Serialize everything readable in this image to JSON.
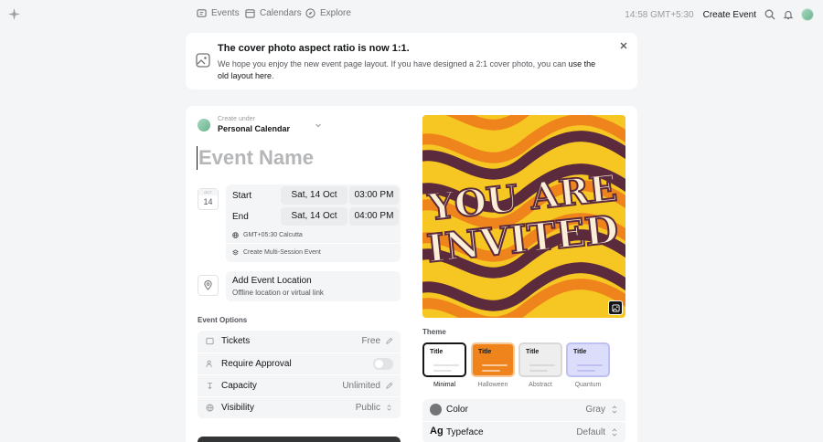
{
  "nav": {
    "logo_icon": "sparkle-icon",
    "items": [
      {
        "label": "Events",
        "icon": "ticket-icon"
      },
      {
        "label": "Calendars",
        "icon": "calendar-icon"
      },
      {
        "label": "Explore",
        "icon": "compass-icon"
      }
    ],
    "time": "14:58 GMT+5:30",
    "create_label": "Create Event"
  },
  "banner": {
    "title": "The cover photo aspect ratio is now 1:1.",
    "text": "We hope you enjoy the new event page layout. If you have designed a 2:1 cover photo, you can ",
    "link": "use the old layout here",
    "suffix": "."
  },
  "event": {
    "create_under": "Create under",
    "calendar": "Personal Calendar",
    "name_placeholder": "Event Name",
    "date_badge": {
      "month": "OCT",
      "day": "14"
    },
    "start": {
      "label": "Start",
      "date": "Sat, 14 Oct",
      "time": "03:00 PM"
    },
    "end": {
      "label": "End",
      "date": "Sat, 14 Oct",
      "time": "04:00 PM"
    },
    "timezone": "GMT+05:30 Calcutta",
    "multi_session": "Create Multi-Session Event",
    "location": {
      "title": "Add Event Location",
      "subtitle": "Offline location or virtual link"
    }
  },
  "options": {
    "label": "Event Options",
    "rows": [
      {
        "label": "Tickets",
        "value": "Free",
        "icon": "ticket-icon",
        "action": "pencil-icon"
      },
      {
        "label": "Require Approval",
        "value": "",
        "icon": "person-check-icon",
        "action": "toggle",
        "enabled": false
      },
      {
        "label": "Capacity",
        "value": "Unlimited",
        "icon": "capacity-icon",
        "action": "pencil-icon"
      },
      {
        "label": "Visibility",
        "value": "Public",
        "icon": "globe-icon",
        "action": "updown-chevron-icon"
      }
    ]
  },
  "cover": {
    "text_line1": "YOU ARE",
    "text_line2": "INVITED",
    "colors": {
      "purple": "#5b2a3c",
      "orange": "#f0841c",
      "yellow": "#f6c623",
      "cream": "#fbeed6"
    }
  },
  "theme": {
    "label": "Theme",
    "options": [
      {
        "name": "Minimal",
        "title": "Title",
        "selected": true,
        "bg": "#ffffff",
        "line": "#e2e3e5",
        "fg": "#131517"
      },
      {
        "name": "Halloween",
        "title": "Title",
        "selected": false,
        "bg": "#f0841c",
        "line": "#f7c89a",
        "fg": "#131517"
      },
      {
        "name": "Abstract",
        "title": "Title",
        "selected": false,
        "bg": "#eeeeee",
        "line": "#d8d8d8",
        "fg": "#131517"
      },
      {
        "name": "Quantum",
        "title": "Title",
        "selected": false,
        "bg": "#dcdcfb",
        "line": "#bfc0f2",
        "fg": "#131517"
      }
    ]
  },
  "appearance": {
    "color_label": "Color",
    "color_value": "Gray",
    "typeface_label": "Typeface",
    "typeface_value": "Default",
    "typeface_glyph": "Ag"
  }
}
